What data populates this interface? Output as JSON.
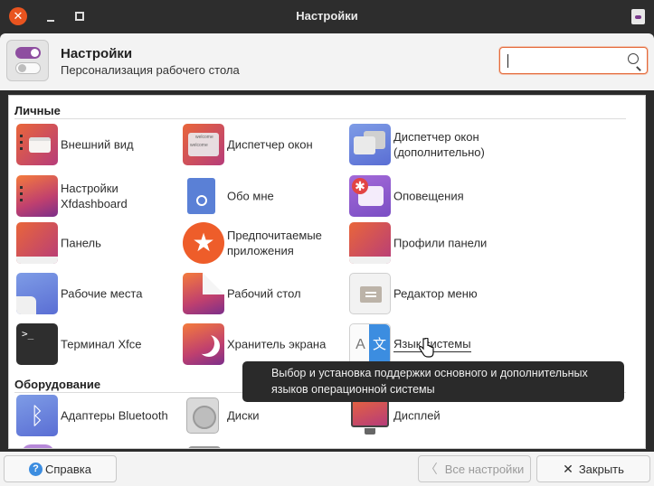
{
  "window": {
    "title": "Настройки",
    "close_glyph": "✕"
  },
  "header": {
    "title": "Настройки",
    "subtitle": "Персонализация рабочего стола",
    "search_placeholder": ""
  },
  "sections": {
    "personal": "Личные",
    "hardware": "Оборудование"
  },
  "items": {
    "appearance": "Внешний вид",
    "wm": "Диспетчер окон",
    "wm_tweaks": "Диспетчер окон\n(дополнительно)",
    "xfdashboard": "Настройки\nXfdashboard",
    "about_me": "Обо мне",
    "notifications": "Оповещения",
    "panel": "Панель",
    "preferred_apps": "Предпочитаемые\nприложения",
    "panel_profiles": "Профили панели",
    "workspaces": "Рабочие места",
    "desktop": "Рабочий стол",
    "menu_editor": "Редактор меню",
    "terminal": "Терминал Xfce",
    "screensaver": "Хранитель экрана",
    "language": "Язык системы",
    "bluetooth": "Адаптеры Bluetooth",
    "disks": "Диски",
    "display": "Дисплей"
  },
  "icons": {
    "terminal_prompt": ">_",
    "lang_a": "A",
    "lang_b": "文",
    "star": "★",
    "notification_badge": "✱",
    "bluetooth": "ᛒ",
    "wm_preview_1": "welcome",
    "wm_preview_2": "welcome"
  },
  "tooltip": "Выбор и установка поддержки основного и дополнительных языков операционной системы",
  "footer": {
    "help": "Справка",
    "help_glyph": "?",
    "all_settings": "Все настройки",
    "all_settings_glyph": "〈",
    "close": "Закрыть",
    "close_glyph": "✕"
  },
  "colors": {
    "accent": "#e46a3b",
    "titlebar": "#2d2d2d",
    "close": "#e9541f"
  }
}
